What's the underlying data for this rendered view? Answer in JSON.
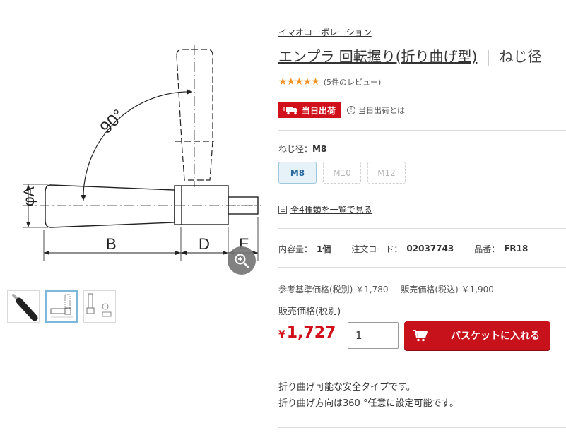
{
  "gallery": {
    "diagram": {
      "angle_label": "90°",
      "dim_a": "φA",
      "dim_b": "B",
      "dim_d": "D",
      "dim_e": "E"
    },
    "zoom_icon": "zoom-in-icon",
    "thumbnails": [
      {
        "name": "product-photo",
        "active": false
      },
      {
        "name": "dimension-drawing",
        "active": true
      },
      {
        "name": "variant-drawing",
        "active": false
      }
    ]
  },
  "product": {
    "maker": "イマオコーポレーション",
    "title": "エンプラ 回転握り(折り曲げ型)",
    "title_suffix": "ねじ径",
    "stars": "★★★★★",
    "rating_count": 5,
    "review_text": "(5件のレビュー)",
    "shipping_badge": "当日出荷",
    "shipping_info": "当日出荷とは",
    "size_label": "ねじ径：",
    "size_value": "M8",
    "sizes": [
      {
        "label": "M8",
        "selected": true,
        "available": true
      },
      {
        "label": "M10",
        "selected": false,
        "available": false
      },
      {
        "label": "M12",
        "selected": false,
        "available": false
      }
    ],
    "all_types_link": "全4種類を一覧で見る",
    "specs": {
      "content_label": "内容量：",
      "content_value": "1個",
      "order_code_label": "注文コード：",
      "order_code_value": "02037743",
      "part_no_label": "品番：",
      "part_no_value": "FR18"
    },
    "reference_price": "参考基準価格(税別) ￥1,780",
    "sale_price_incl": "販売価格(税込) ￥1,900",
    "sale_price_label": "販売価格(税別)",
    "price_currency": "¥",
    "price_value": "1,727",
    "quantity": "1",
    "cart_button": "バスケットに入れる",
    "description": [
      "折り曲げ可能な安全タイプです。",
      "折り曲げ方向は360 °任意に設定可能です。"
    ]
  },
  "colors": {
    "accent_red": "#d0111b",
    "star_orange": "#f29225",
    "selected_blue": "#e6f1f8"
  }
}
